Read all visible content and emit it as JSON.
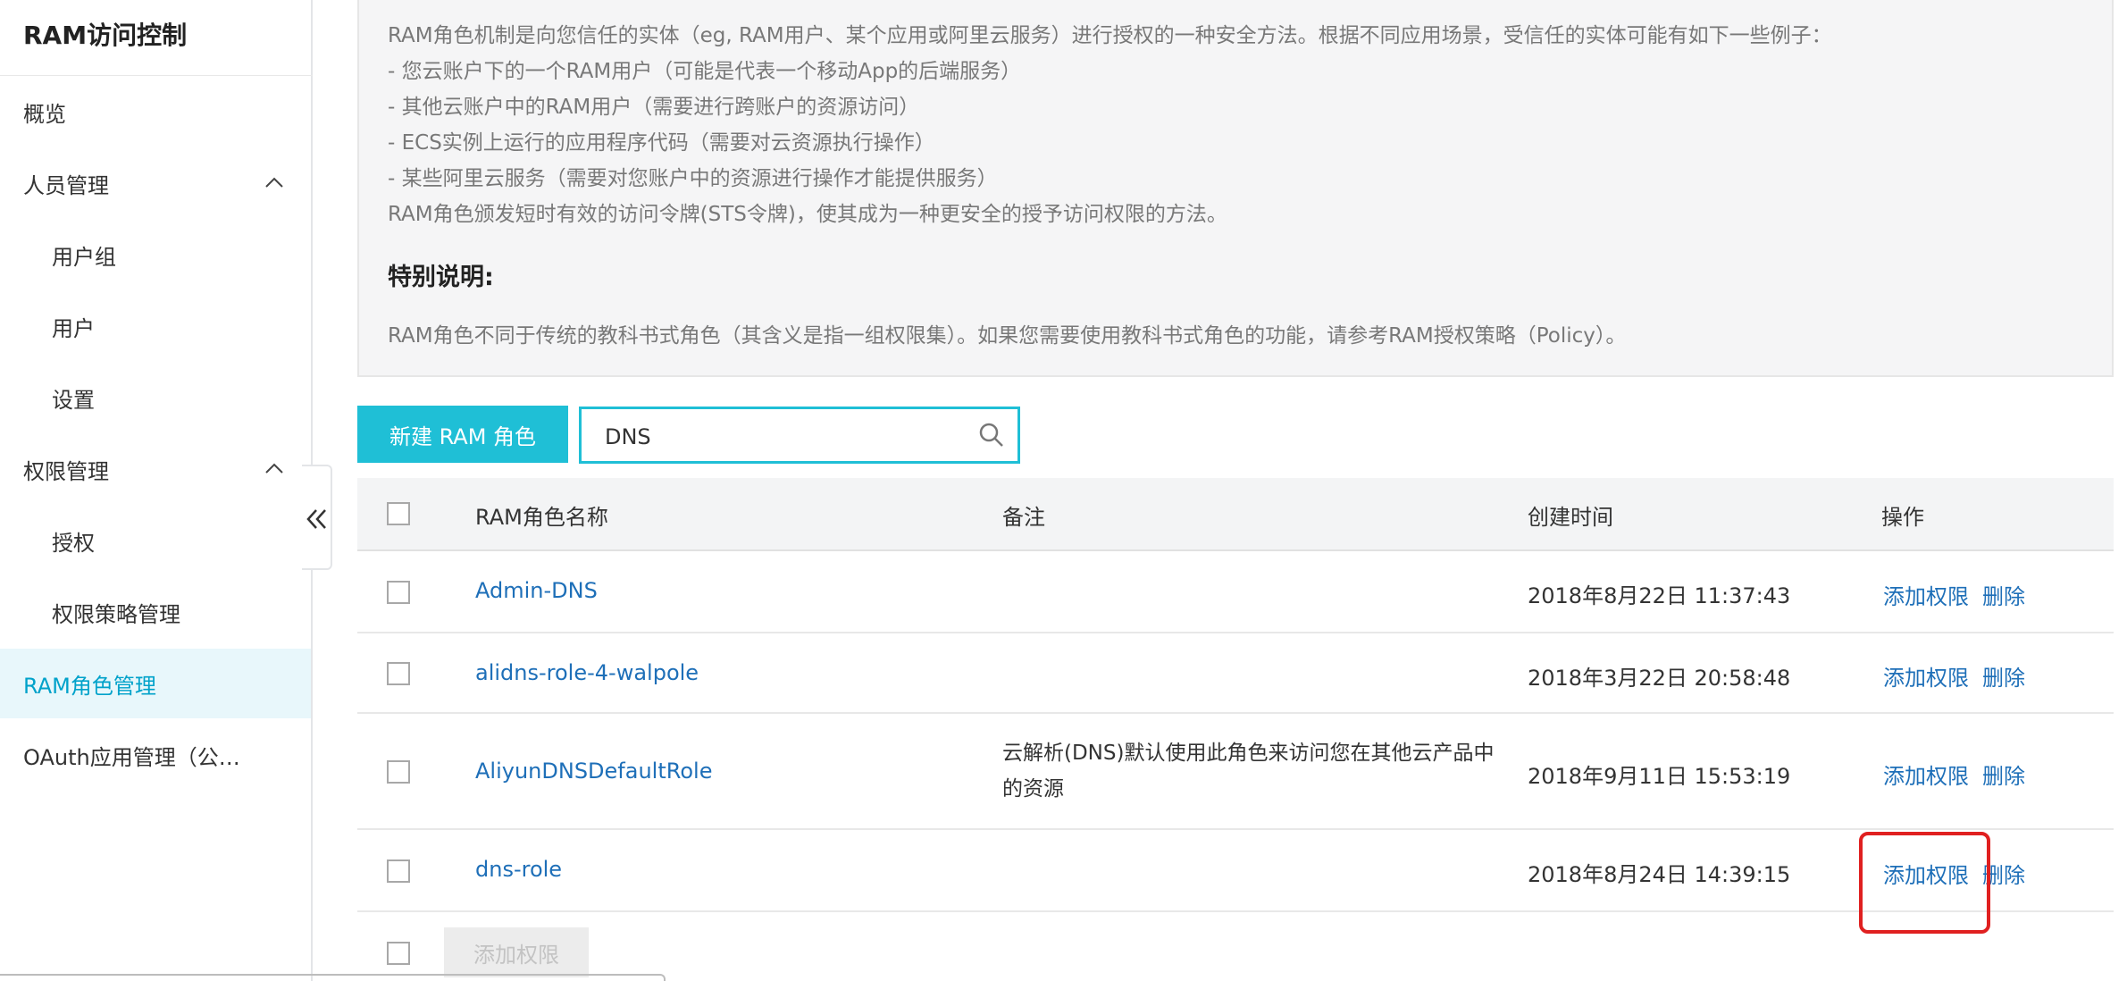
{
  "sidebar": {
    "title": "RAM访问控制",
    "items": [
      {
        "label": "概览"
      },
      {
        "label": "人员管理"
      },
      {
        "label": "用户组"
      },
      {
        "label": "用户"
      },
      {
        "label": "设置"
      },
      {
        "label": "权限管理"
      },
      {
        "label": "授权"
      },
      {
        "label": "权限策略管理"
      },
      {
        "label": "RAM角色管理"
      },
      {
        "label": "OAuth应用管理（公…"
      }
    ],
    "active_item": "RAM角色管理"
  },
  "info": {
    "lines": [
      "RAM角色机制是向您信任的实体（eg, RAM用户、某个应用或阿里云服务）进行授权的一种安全方法。根据不同应用场景，受信任的实体可能有如下一些例子：",
      "- 您云账户下的一个RAM用户（可能是代表一个移动App的后端服务）",
      "- 其他云账户中的RAM用户（需要进行跨账户的资源访问）",
      "- ECS实例上运行的应用程序代码（需要对云资源执行操作）",
      "- 某些阿里云服务（需要对您账户中的资源进行操作才能提供服务）",
      "RAM角色颁发短时有效的访问令牌(STS令牌)，使其成为一种更安全的授予访问权限的方法。"
    ],
    "special_heading": "特别说明:",
    "special_text": "RAM角色不同于传统的教科书式角色（其含义是指一组权限集）。如果您需要使用教科书式角色的功能，请参考RAM授权策略（Policy）。"
  },
  "toolbar": {
    "new_role_label": "新建 RAM 角色",
    "search_value": "DNS"
  },
  "table": {
    "headers": [
      "RAM角色名称",
      "备注",
      "创建时间",
      "操作"
    ],
    "rows": [
      {
        "name": "Admin-DNS",
        "remark": "",
        "created": "2018年8月22日 11:37:43",
        "action_add": "添加权限",
        "action_delete": "删除"
      },
      {
        "name": "alidns-role-4-walpole",
        "remark": "",
        "created": "2018年3月22日 20:58:48",
        "action_add": "添加权限",
        "action_delete": "删除"
      },
      {
        "name": "AliyunDNSDefaultRole",
        "remark": "云解析(DNS)默认使用此角色来访问您在其他云产品中的资源",
        "created": "2018年9月11日 15:53:19",
        "action_add": "添加权限",
        "action_delete": "删除"
      },
      {
        "name": "dns-role",
        "remark": "",
        "created": "2018年8月24日 14:39:15",
        "action_add": "添加权限",
        "action_delete": "删除"
      }
    ],
    "bulk_add_label": "添加权限"
  },
  "colors": {
    "accent": "#1fbfd6",
    "link": "#1e6fb8",
    "highlight": "#e02020",
    "active_nav_bg": "#e8f7fb"
  },
  "icons": [
    "chevron-up-icon",
    "double-chevron-left-icon",
    "search-icon"
  ]
}
